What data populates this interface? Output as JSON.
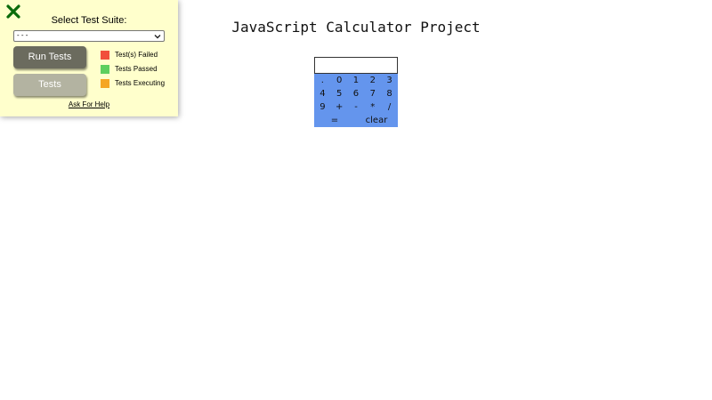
{
  "test_panel": {
    "suite_label": "Select Test Suite:",
    "suite_selected": "- - -",
    "run_button": "Run Tests",
    "tests_button": "Tests",
    "legend": [
      {
        "label": "Test(s) Failed",
        "color": "#f1503b"
      },
      {
        "label": "Tests Passed",
        "color": "#5ecf5e"
      },
      {
        "label": "Tests Executing",
        "color": "#f5a623"
      }
    ],
    "help_link": "Ask For Help",
    "close_icon_color": "#0a6b0a"
  },
  "title": "JavaScript Calculator Project",
  "calculator": {
    "display_value": "",
    "keypad_color": "#6495ed",
    "rows": [
      [
        ".",
        "0",
        "1",
        "2",
        "3"
      ],
      [
        "4",
        "5",
        "6",
        "7",
        "8"
      ],
      [
        "9",
        "+",
        "-",
        "*",
        "/"
      ]
    ],
    "equals_label": "=",
    "clear_label": "clear"
  }
}
